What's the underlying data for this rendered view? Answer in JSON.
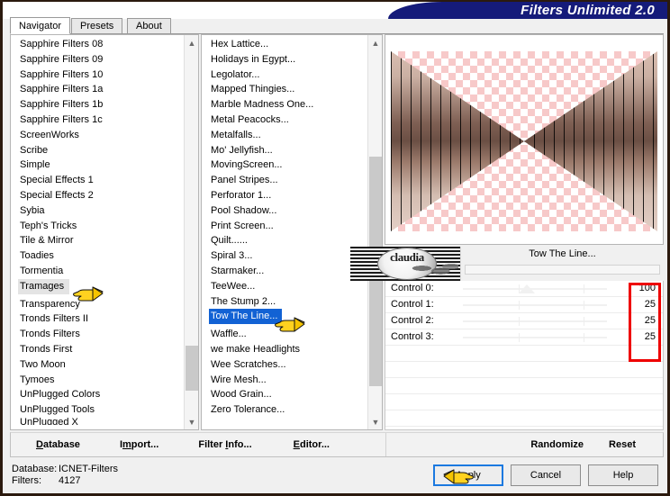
{
  "window": {
    "title": "Filters Unlimited 2.0"
  },
  "tabs": [
    {
      "label": "Navigator",
      "active": true
    },
    {
      "label": "Presets",
      "active": false
    },
    {
      "label": "About",
      "active": false
    }
  ],
  "category_list": {
    "name": "filter-category-list",
    "selected": "Tramages",
    "items": [
      "Sapphire Filters 08",
      "Sapphire Filters 09",
      "Sapphire Filters 10",
      "Sapphire Filters 1a",
      "Sapphire Filters 1b",
      "Sapphire Filters 1c",
      "ScreenWorks",
      "Scribe",
      "Simple",
      "Special Effects 1",
      "Special Effects 2",
      "Sybia",
      "Teph's Tricks",
      "Tile & Mirror",
      "Toadies",
      "Tormentia",
      "Tramages",
      "Transparency",
      "Tronds Filters II",
      "Tronds Filters",
      "Tronds First",
      "Two Moon",
      "Tymoes",
      "UnPlugged Colors",
      "UnPlugged Tools"
    ],
    "clipped_item": "UnPlugged X"
  },
  "filter_list": {
    "name": "filter-effect-list",
    "selected": "Tow The Line...",
    "items": [
      "Hex Lattice...",
      "Holidays in Egypt...",
      "Legolator...",
      "Mapped Thingies...",
      "Marble Madness One...",
      "Metal Peacocks...",
      "Metalfalls...",
      "Mo' Jellyfish...",
      "MovingScreen...",
      "Panel Stripes...",
      "Perforator 1...",
      "Pool Shadow...",
      "Print Screen...",
      "Quilt......",
      "Spiral 3...",
      "Starmaker...",
      "TeeWee...",
      "The Stump 2...",
      "Tow The Line...",
      "Waffle...",
      "we make Headlights",
      "Wee Scratches...",
      "Wire Mesh...",
      "Wood Grain...",
      "Zero Tolerance..."
    ]
  },
  "preview": {
    "name": "filter-preview",
    "alt": "pink transparency checkerboard with two striped brown triangles"
  },
  "filter_header": {
    "logo_text": "claudia",
    "title": "Tow The Line..."
  },
  "controls": [
    {
      "label": "Control 0:",
      "value": "100"
    },
    {
      "label": "Control 1:",
      "value": "25"
    },
    {
      "label": "Control 2:",
      "value": "25"
    },
    {
      "label": "Control 3:",
      "value": "25"
    }
  ],
  "toolbar": {
    "database_label": "Database",
    "database_acc": "D",
    "import_label": "Import...",
    "import_acc": "I",
    "filter_info_label": "Filter Info...",
    "filter_info_acc": "I",
    "editor_label": "Editor...",
    "editor_acc": "E",
    "randomize_label": "Randomize",
    "reset_label": "Reset"
  },
  "status": {
    "database_key": "Database:",
    "database_value": "ICNET-Filters",
    "filters_key": "Filters:",
    "filters_value": "4127"
  },
  "dialog_buttons": {
    "apply_label": "Apply",
    "cancel_label": "Cancel",
    "help_label": "Help"
  },
  "colors": {
    "title_banner": "#151b7a",
    "selection_blue": "#1262d4",
    "selection_gray": "#e4e4e4",
    "focus_blue": "#1b79e0",
    "highlight_red": "#ee0000",
    "checker_pink": "#f7c9c9"
  }
}
